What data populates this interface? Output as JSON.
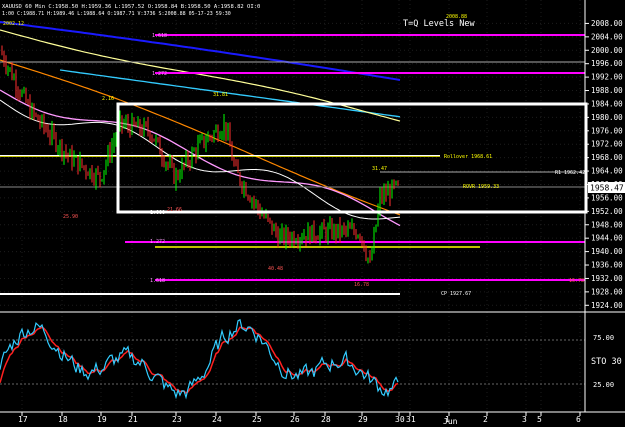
{
  "header": {
    "symbol_line": "XAUUSD 60 Min  C:1958.50  H:1959.36  L:1957.52  O:1958.84  B:1958.50  A:1958.82  OI:0",
    "sub_line": "1:00  C:1988.71  H:1989.46  L:1988.64  O:1987.71  V:3736  S:2008.88 05-17-23 59:30",
    "left_badge": "2002.12",
    "annotation": "T=Q Levels New"
  },
  "colors": {
    "background": "#000000",
    "up_bar": "#00ff00",
    "down_bar": "#ff3030",
    "level_magenta": "#ff00ff",
    "level_yellow": "#ffff00",
    "box_white": "#ffffff",
    "ma_blue": "#1a1aff",
    "ma_cyan": "#33ccff",
    "ma_light_yellow": "#ffff99",
    "ma_orange": "#ff8800",
    "ma_pink": "#ff99ff",
    "stoch_k": "#33ccff",
    "stoch_d": "#ff2020"
  },
  "price_axis": {
    "ticks": [
      "2008.00",
      "2004.00",
      "2000.00",
      "1996.00",
      "1992.00",
      "1988.00",
      "1984.00",
      "1980.00",
      "1976.00",
      "1972.00",
      "1968.00",
      "1964.00",
      "1960.00",
      "1956.00",
      "1952.00",
      "1948.00",
      "1944.00",
      "1940.00",
      "1936.00",
      "1932.00",
      "1928.00",
      "1924.00"
    ],
    "current_price": "1958.47"
  },
  "time_axis": {
    "labels": [
      "17",
      "18",
      "19",
      "21",
      "23",
      "24",
      "25",
      "26",
      "28",
      "29",
      "30",
      "31",
      "1",
      "2",
      "3",
      "5",
      "6"
    ],
    "month_label": "Jun"
  },
  "levels": [
    {
      "label": "1.618"
    },
    {
      "label": "1.272"
    },
    {
      "label": "Rollover 1968.61"
    },
    {
      "label": "R1 1962.42"
    },
    {
      "label": "ROVR 1959.33"
    },
    {
      "label": "1.000"
    },
    {
      "label": "1.272"
    },
    {
      "label": "1.618"
    },
    {
      "label": "CP 1927.67"
    }
  ],
  "price_notes": [
    "31.81",
    "31.47",
    "21.66",
    "25.90",
    "2.16",
    "40.48",
    "16.78",
    "16.78",
    "2008.88"
  ],
  "oscillator": {
    "label": "STO  30",
    "ticks": [
      "75.00",
      "25.00"
    ]
  },
  "chart_data": {
    "type": "line",
    "title": "T=Q Levels New",
    "ylim": [
      1922,
      2012
    ],
    "price_series_note": "XAUUSD 60 Min",
    "osc_ylim": [
      0,
      100
    ]
  }
}
